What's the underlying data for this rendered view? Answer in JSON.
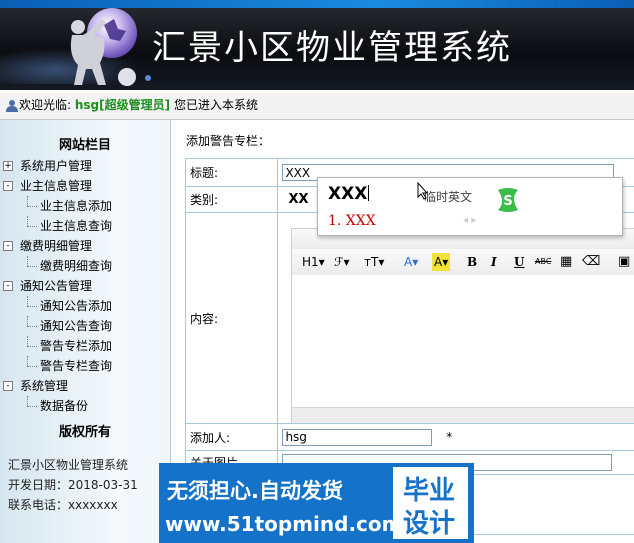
{
  "header": {
    "title": "汇景小区物业管理系统"
  },
  "welcome": {
    "prefix": "欢迎光临:",
    "username": "hsg[超级管理员]",
    "suffix": "您已进入本系统"
  },
  "sidebar": {
    "heading": "网站栏目",
    "tree": [
      {
        "label": "系统用户管理",
        "level": 0,
        "toggle": "+"
      },
      {
        "label": "业主信息管理",
        "level": 0,
        "toggle": "-"
      },
      {
        "label": "业主信息添加",
        "level": 1
      },
      {
        "label": "业主信息查询",
        "level": 1
      },
      {
        "label": "缴费明细管理",
        "level": 0,
        "toggle": "-"
      },
      {
        "label": "缴费明细查询",
        "level": 1
      },
      {
        "label": "通知公告管理",
        "level": 0,
        "toggle": "-"
      },
      {
        "label": "通知公告添加",
        "level": 1
      },
      {
        "label": "通知公告查询",
        "level": 1
      },
      {
        "label": "警告专栏添加",
        "level": 1
      },
      {
        "label": "警告专栏查询",
        "level": 1
      },
      {
        "label": "系统管理",
        "level": 0,
        "toggle": "-"
      },
      {
        "label": "数据备份",
        "level": 1
      }
    ],
    "copyright": "版权所有",
    "system_name": "汇景小区物业管理系统",
    "dev_date": "开发日期：2018-03-31",
    "phone": "联系电话：xxxxxxx"
  },
  "main": {
    "section_title": "添加警告专栏：",
    "fields": {
      "title_label": "标题:",
      "title_value": "XXX",
      "category_label": "类别:",
      "category_value": "XX",
      "content_label": "内容:",
      "adder_label": "添加人:",
      "adder_value": "hsg",
      "required_mark": "*",
      "cutoff_label": "关于图片"
    },
    "toolbar": {
      "h1": "H1",
      "font_family": "ℱ",
      "font_size": "тT",
      "font_color": "A",
      "highlight": "A",
      "bold": "B",
      "italic": "I",
      "underline": "U",
      "strike": "ABC"
    }
  },
  "ime": {
    "composition": "XXX",
    "mode": "临时英文",
    "candidate": "1. XXX",
    "nav": "◂ ▸"
  },
  "watermark": {
    "line1": "无须担心.自动发货",
    "line2": "www.51topmind.com",
    "box_line1": "毕业",
    "box_line2": "设计"
  },
  "colors": {
    "accent_blue": "#1572c9",
    "username_green": "#1f8f1f",
    "candidate_red": "#c80000"
  }
}
